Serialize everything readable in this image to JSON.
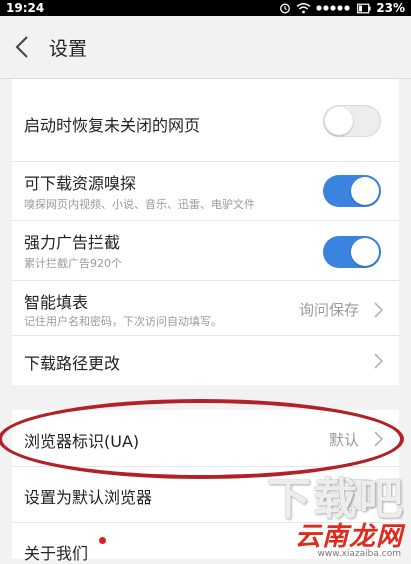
{
  "status_bar": {
    "time": "19:24",
    "battery": "23%",
    "icons": [
      "alarm-icon",
      "wifi-icon",
      "signal-icon",
      "battery-icon"
    ]
  },
  "header": {
    "title": "设置"
  },
  "settings": {
    "restore_pages": {
      "title": "启动时恢复未关闭的网页",
      "enabled": false
    },
    "resource_sniff": {
      "title": "可下载资源嗅探",
      "subtitle": "嗅探网页内视频、小说、音乐、迅雷、电驴文件",
      "enabled": true
    },
    "ad_block": {
      "title": "强力广告拦截",
      "subtitle": "累计拦截广告920个",
      "enabled": true
    },
    "autofill": {
      "title": "智能填表",
      "subtitle": "记住用户名和密码，下次访问自动填写。",
      "value": "询问保存"
    },
    "download_path": {
      "title": "下载路径更改"
    },
    "user_agent": {
      "title": "浏览器标识(UA)",
      "value": "默认"
    },
    "default_browser": {
      "title": "设置为默认浏览器"
    },
    "about": {
      "title": "关于我们"
    }
  },
  "watermark": {
    "big": "下载吧",
    "brand": "云南龙网",
    "url": "www.xiazaiba.com"
  },
  "colors": {
    "accent": "#3a84e0",
    "annotation": "#b32027",
    "badge": "#e21c1c"
  }
}
